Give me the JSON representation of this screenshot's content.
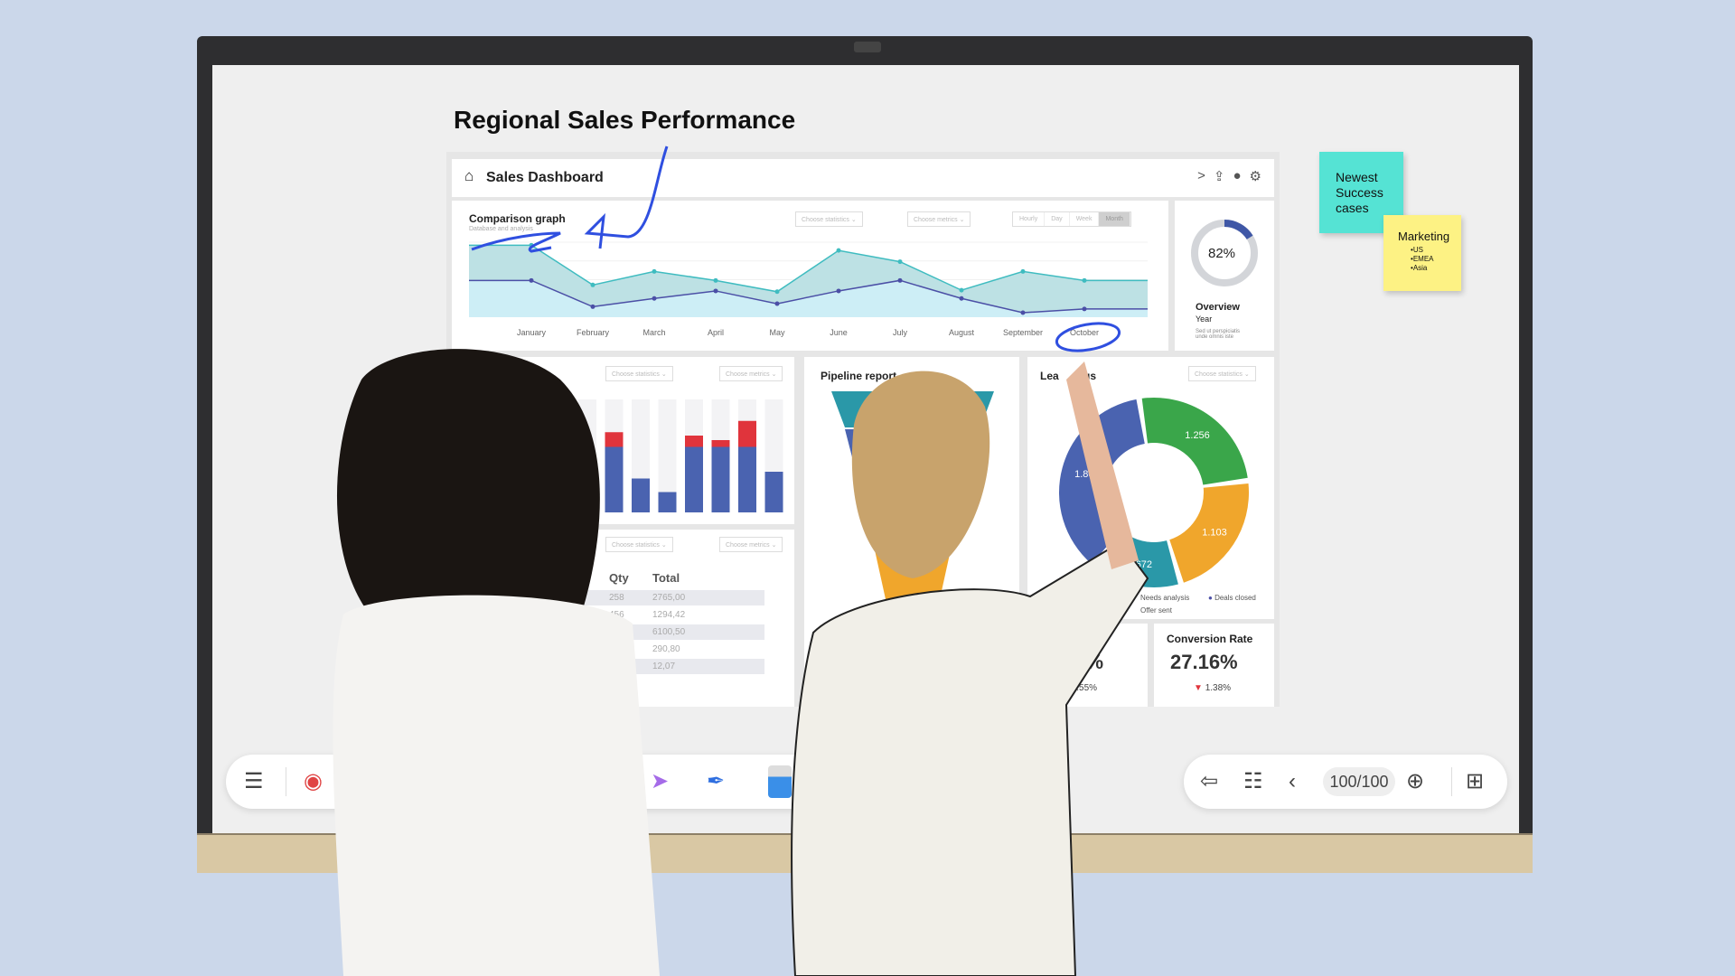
{
  "board": {
    "title": "Regional Sales Performance"
  },
  "dashboard": {
    "title": "Sales Dashboard",
    "header_icons": [
      "share-icon",
      "upload-icon",
      "user-icon",
      "gear-icon"
    ],
    "comparison": {
      "title": "Comparison graph",
      "subtitle": "Database and analysis",
      "dropdowns": [
        "Choose statistics",
        "Choose metrics"
      ],
      "range_tabs": [
        "Hourly",
        "Day",
        "Week",
        "Month"
      ],
      "active_range": "Month"
    },
    "overview": {
      "percent": "82%",
      "value": 82,
      "title": "Overview",
      "period": "Year",
      "text": "Sed ut perspiciatis unde omnis iste"
    },
    "bars": {
      "dropdowns": [
        "Choose statistics",
        "Choose metrics"
      ]
    },
    "pipeline": {
      "title": "Pipeline report"
    },
    "lead_status": {
      "title_visible": [
        "Lea",
        "tus"
      ],
      "dropdown": "Choose statistics",
      "legend": [
        "Needs analysis",
        "Deals closed",
        "Offer sent"
      ]
    },
    "table": {
      "dropdowns": [
        "Choose statistics",
        "Choose metrics"
      ],
      "headers": [
        "Qty",
        "Total"
      ],
      "rows": [
        [
          "258",
          "2765,00"
        ],
        [
          "456",
          "1294,42"
        ],
        [
          "921",
          "6100,50"
        ],
        [
          "",
          "290,80"
        ],
        [
          "",
          "12,07"
        ]
      ]
    },
    "kpi1": {
      "value": "84%",
      "change": "3.55%",
      "trend": "up"
    },
    "kpi2": {
      "title": "Conversion Rate",
      "value": "27.16%",
      "change": "1.38%",
      "trend": "down"
    }
  },
  "notes": [
    {
      "text": "Newest Success cases",
      "color": "#55e3d4"
    },
    {
      "title": "Marketing",
      "items": [
        "US",
        "EMEA",
        "Asia"
      ],
      "color": "#fdf284"
    }
  ],
  "toolbar_left": {
    "icons": [
      "menu-icon",
      "record-icon",
      "add-user-icon",
      "lasso-select-icon",
      "pen-icon",
      "eraser-icon"
    ]
  },
  "toolbar_right": {
    "page": "100/100",
    "icons": [
      "back-icon",
      "settings-panel-icon",
      "prev-page-icon",
      "add-page-icon",
      "map-zoom-icon"
    ]
  },
  "colors": {
    "teal": "#3fbcc0",
    "purple": "#4b4fa6",
    "blue": "#4a63b0",
    "red": "#e0343c",
    "green": "#3aa64a",
    "orange": "#f0a62c",
    "donut_teal": "#2a98a8",
    "ink": "#2f4fe0"
  },
  "chart_data": [
    {
      "type": "area",
      "title": "Comparison graph",
      "categories": [
        "January",
        "February",
        "March",
        "April",
        "May",
        "June",
        "July",
        "August",
        "September",
        "October"
      ],
      "series": [
        {
          "values": [
            96,
            43,
            61,
            49,
            34,
            89,
            74,
            36,
            61,
            49
          ]
        },
        {
          "values": [
            49,
            14,
            25,
            35,
            18,
            35,
            49,
            25,
            6,
            11
          ]
        }
      ],
      "grid": true
    },
    {
      "type": "bar",
      "stacked": true,
      "series": [
        {
          "values": [
            33,
            58,
            30,
            18,
            58,
            58,
            58,
            36
          ]
        },
        {
          "values": [
            0,
            13,
            0,
            0,
            10,
            6,
            23,
            0
          ]
        }
      ]
    },
    {
      "type": "pie",
      "donut": true,
      "labels": [
        "1.256",
        "1.103",
        "672",
        "94",
        "1.80"
      ],
      "values": [
        1256,
        1103,
        672,
        94,
        1800
      ],
      "colors": [
        "#3aa64a",
        "#f0a62c",
        "#2a98a8",
        "#e0343c",
        "#4a63b0"
      ]
    }
  ]
}
